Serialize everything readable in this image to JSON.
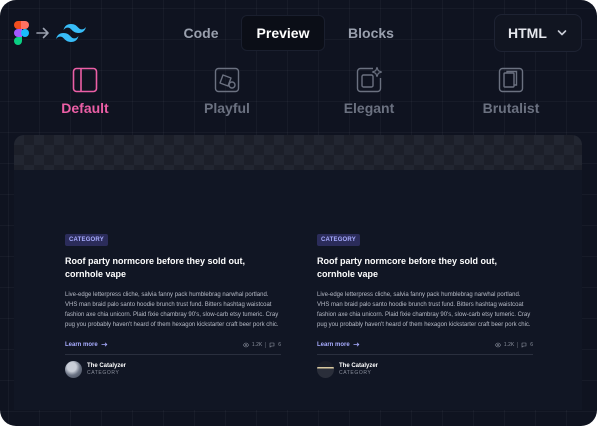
{
  "toolbar": {
    "tabs": [
      "Code",
      "Preview",
      "Blocks"
    ],
    "active_tab": "Preview",
    "language": "HTML",
    "icons": [
      "figma-icon",
      "arrow-right-icon",
      "tailwind-icon",
      "chevron-down-icon"
    ]
  },
  "styles": {
    "items": [
      {
        "label": "Default",
        "icon": "layout-sidebar-icon"
      },
      {
        "label": "Playful",
        "icon": "shapes-icon"
      },
      {
        "label": "Elegant",
        "icon": "sparkle-frame-icon"
      },
      {
        "label": "Brutalist",
        "icon": "stacked-frames-icon"
      }
    ],
    "active": "Default"
  },
  "cards": [
    {
      "category": "CATEGORY",
      "title": "Roof party normcore before they sold out, cornhole vape",
      "body": "Live-edge letterpress cliche, salvia fanny pack humblebrag narwhal portland. VHS man braid palo santo hoodie brunch trust fund. Bitters hashtag waistcoat fashion axe chia unicorn. Plaid fixie chambray 90's, slow-carb etsy tumeric. Cray pug you probably haven't heard of them hexagon kickstarter craft beer pork chic.",
      "link": "Learn more",
      "views": "1.2K",
      "comments": "6",
      "author": "The Catalyzer",
      "author_role": "CATEGORY"
    },
    {
      "category": "CATEGORY",
      "title": "Roof party normcore before they sold out, cornhole vape",
      "body": "Live-edge letterpress cliche, salvia fanny pack humblebrag narwhal portland. VHS man braid palo santo hoodie brunch trust fund. Bitters hashtag waistcoat fashion axe chia unicorn. Plaid fixie chambray 90's, slow-carb etsy tumeric. Cray pug you probably haven't heard of them hexagon kickstarter craft beer pork chic.",
      "link": "Learn more",
      "views": "1.2K",
      "comments": "6",
      "author": "The Catalyzer",
      "author_role": "CATEGORY"
    }
  ],
  "colors": {
    "background": "#0f1320",
    "accent_pink": "#ec5fa6",
    "accent_indigo": "#a8acff"
  }
}
